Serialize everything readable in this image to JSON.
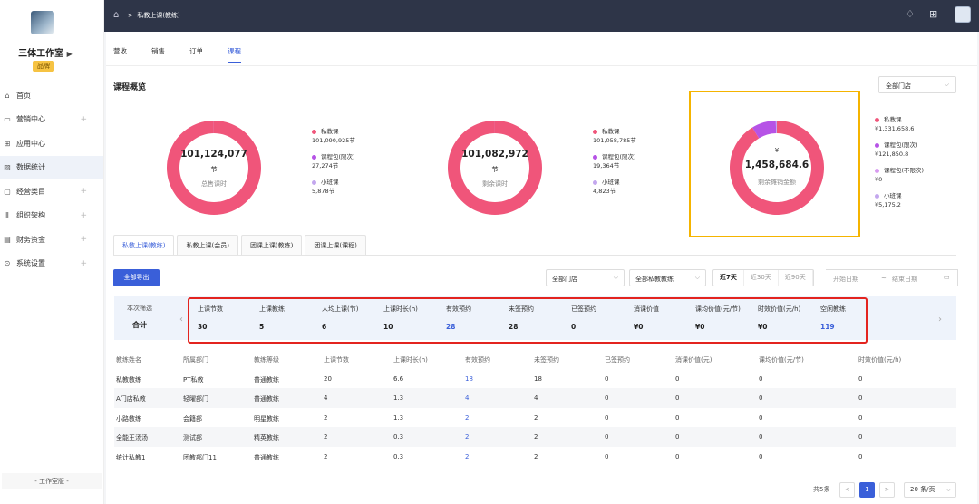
{
  "org": {
    "name": "三体工作室",
    "tag": "品牌"
  },
  "sidebar": {
    "items": [
      {
        "label": "首页",
        "icon": "home-icon",
        "glyph": "⌂",
        "expand": false
      },
      {
        "label": "营销中心",
        "icon": "marketing-icon",
        "glyph": "▭",
        "expand": true
      },
      {
        "label": "应用中心",
        "icon": "apps-icon",
        "glyph": "⊞",
        "expand": false
      },
      {
        "label": "数据统计",
        "icon": "chart-icon",
        "glyph": "▨",
        "expand": false
      },
      {
        "label": "经营类目",
        "icon": "category-icon",
        "glyph": "▢",
        "expand": true
      },
      {
        "label": "组织架构",
        "icon": "org-icon",
        "glyph": "Ⅱ",
        "expand": true
      },
      {
        "label": "财务资金",
        "icon": "finance-icon",
        "glyph": "▤",
        "expand": true
      },
      {
        "label": "系统设置",
        "icon": "settings-icon",
        "glyph": "⊙",
        "expand": true
      }
    ],
    "plus": "+",
    "version": "- 工作室版 -"
  },
  "topbar": {
    "breadcrumb": "私教上课(教练)",
    "sep": ">"
  },
  "tabs": [
    "营收",
    "销售",
    "订单",
    "课程"
  ],
  "overview": {
    "title": "课程概览",
    "store_select": "全部门店",
    "donuts": [
      {
        "value": "101,124,077",
        "sub": "节",
        "label": "总售课时",
        "legend": [
          {
            "name": "私教课",
            "value": "101,090,925节",
            "color": "#f0557a"
          },
          {
            "name": "课程包(限次)",
            "value": "27,274节",
            "color": "#b653e6"
          },
          {
            "name": "小班课",
            "value": "5,878节",
            "color": "#c3a7ee"
          }
        ]
      },
      {
        "value": "101,082,972",
        "sub": "节",
        "label": "剩余课时",
        "legend": [
          {
            "name": "私教课",
            "value": "101,058,785节",
            "color": "#f0557a"
          },
          {
            "name": "课程包(限次)",
            "value": "19,364节",
            "color": "#b653e6"
          },
          {
            "name": "小班课",
            "value": "4,823节",
            "color": "#c3a7ee"
          }
        ]
      },
      {
        "currency": "¥",
        "value": "1,458,684.6",
        "label": "剩余摊销金额",
        "legend": [
          {
            "name": "私教课",
            "value": "¥1,331,658.6",
            "color": "#f0557a"
          },
          {
            "name": "课程包(限次)",
            "value": "¥121,850.8",
            "color": "#b653e6"
          },
          {
            "name": "课程包(不限次)",
            "value": "¥0",
            "color": "#d89af0"
          },
          {
            "name": "小班课",
            "value": "¥5,175.2",
            "color": "#c3a7ee"
          }
        ]
      }
    ]
  },
  "subtabs": [
    "私教上课(教练)",
    "私教上课(会员)",
    "团课上课(教练)",
    "团课上课(课程)"
  ],
  "filters": {
    "export": "全部导出",
    "store": "全部门店",
    "coach": "全部私教教练",
    "periods": [
      "近7天",
      "近30天",
      "近90天"
    ],
    "start_placeholder": "开始日期",
    "range_sep": "~",
    "end_placeholder": "结束日期"
  },
  "summary": {
    "label": "本次筛选",
    "total": "合计",
    "metrics": [
      {
        "label": "上课节数",
        "value": "30"
      },
      {
        "label": "上课教练",
        "value": "5"
      },
      {
        "label": "人均上课(节)",
        "value": "6"
      },
      {
        "label": "上课时长(h)",
        "value": "10"
      },
      {
        "label": "有效预约",
        "value": "28",
        "blue": true
      },
      {
        "label": "未签预约",
        "value": "28"
      },
      {
        "label": "已签预约",
        "value": "0"
      },
      {
        "label": "消课价值",
        "value": "¥0"
      },
      {
        "label": "课均价值(元/节)",
        "value": "¥0"
      },
      {
        "label": "时效价值(元/h)",
        "value": "¥0"
      },
      {
        "label": "空闲教练",
        "value": "119",
        "blue": true
      }
    ]
  },
  "table": {
    "headers": [
      "教练姓名",
      "所属部门",
      "教练等级",
      "上课节数",
      "上课时长(h)",
      "有效预约",
      "未签预约",
      "已签预约",
      "消课价值(元)",
      "课均价值(元/节)",
      "时效价值(元/h)"
    ],
    "rows": [
      [
        "私教教练",
        "PT私教",
        "普通教练",
        "20",
        "6.6",
        "18",
        "18",
        "0",
        "0",
        "0",
        "0"
      ],
      [
        "A门店私教",
        "轻曜部门",
        "普通教练",
        "4",
        "1.3",
        "4",
        "4",
        "0",
        "0",
        "0",
        "0"
      ],
      [
        "小路教练",
        "会籍部",
        "明星教练",
        "2",
        "1.3",
        "2",
        "2",
        "0",
        "0",
        "0",
        "0"
      ],
      [
        "全能王汤汤",
        "测试部",
        "精英教练",
        "2",
        "0.3",
        "2",
        "2",
        "0",
        "0",
        "0",
        "0"
      ],
      [
        "统计私教1",
        "团教部门11",
        "普通教练",
        "2",
        "0.3",
        "2",
        "2",
        "0",
        "0",
        "0",
        "0"
      ]
    ]
  },
  "pagination": {
    "total": "共5条",
    "page": "1",
    "prev": "<",
    "next": ">",
    "size": "20 条/页"
  }
}
